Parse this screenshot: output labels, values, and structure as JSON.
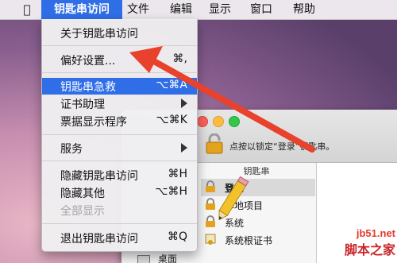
{
  "menubar": {
    "apple_icon": "",
    "items": [
      "钥匙串访问",
      "文件",
      "编辑",
      "显示",
      "窗口",
      "帮助"
    ]
  },
  "dropdown": {
    "about": "关于钥匙串访问",
    "prefs": "偏好设置...",
    "prefs_shortcut": "⌘,",
    "first_aid": "钥匙串急救",
    "first_aid_shortcut": "⌥⌘A",
    "cert_assistant": "证书助理",
    "ticket_viewer": "票据显示程序",
    "ticket_viewer_shortcut": "⌥⌘K",
    "services": "服务",
    "hide_app": "隐藏钥匙串访问",
    "hide_app_shortcut": "⌘H",
    "hide_others": "隐藏其他",
    "hide_others_shortcut": "⌥⌘H",
    "show_all": "全部显示",
    "quit": "退出钥匙串访问",
    "quit_shortcut": "⌘Q"
  },
  "window": {
    "lock_text": "点按以锁定“登录”钥匙串。",
    "sidebar_header": "钥匙串",
    "keychains": [
      "登录",
      "本地项目",
      "系统",
      "系统根证书"
    ],
    "desktop_label": "桌面"
  },
  "watermark": {
    "site": "jb51.net",
    "brand": "脚本之家"
  },
  "colors": {
    "menu_highlight": "#2f6ee7",
    "arrow": "#e8412c"
  }
}
